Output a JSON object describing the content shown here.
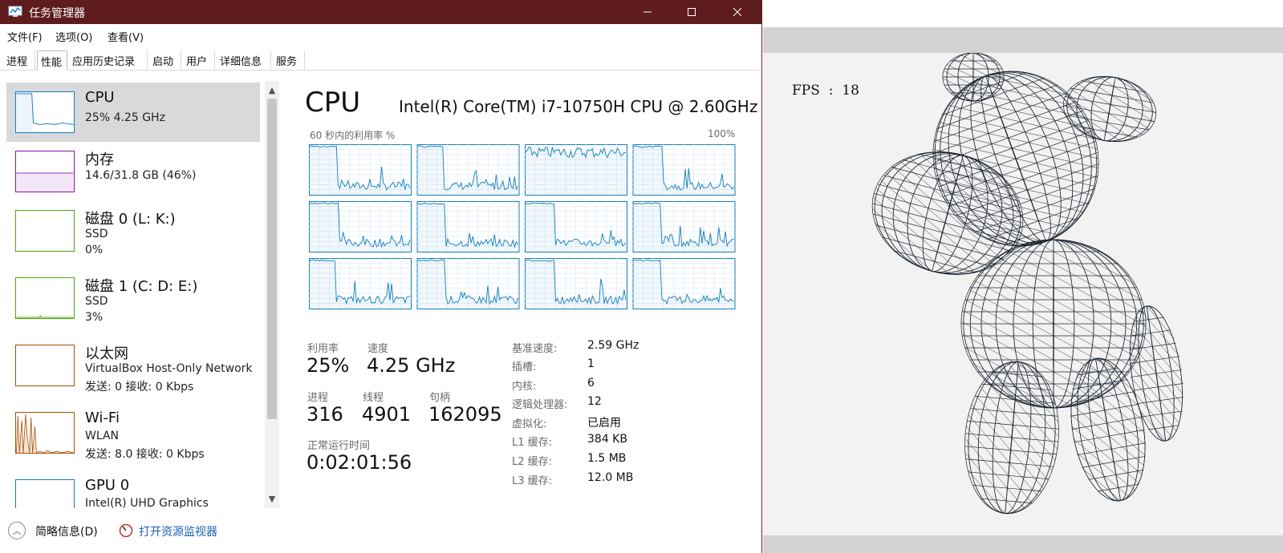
{
  "window": {
    "title": "任务管理器"
  },
  "menu": {
    "file": "文件(F)",
    "options": "选项(O)",
    "view": "查看(V)"
  },
  "tabs": [
    "进程",
    "性能",
    "应用历史记录",
    "启动",
    "用户",
    "详细信息",
    "服务"
  ],
  "sidebar": {
    "items": [
      {
        "title": "CPU",
        "line1": "25% 4.25 GHz",
        "line2": "",
        "color": "#117dbb"
      },
      {
        "title": "内存",
        "line1": "14.6/31.8 GB (46%)",
        "line2": "",
        "color": "#8b12ae"
      },
      {
        "title": "磁盘 0 (L: K:)",
        "line1": "SSD",
        "line2": "0%",
        "color": "#4da60c"
      },
      {
        "title": "磁盘 1 (C: D: E:)",
        "line1": "SSD",
        "line2": "3%",
        "color": "#4da60c"
      },
      {
        "title": "以太网",
        "line1": "VirtualBox Host-Only Network",
        "line2": "发送: 0 接收: 0 Kbps",
        "color": "#a74f01"
      },
      {
        "title": "Wi-Fi",
        "line1": "WLAN",
        "line2": "发送: 8.0 接收: 0 Kbps",
        "color": "#a74f01"
      },
      {
        "title": "GPU 0",
        "line1": "Intel(R) UHD Graphics",
        "line2": "",
        "color": "#117dbb"
      }
    ]
  },
  "cpu": {
    "heading": "CPU",
    "model": "Intel(R) Core(TM) i7-10750H CPU @ 2.60GHz",
    "graph_label": "60 秒内的利用率 %",
    "graph_max": "100%",
    "logical_graphs": 12,
    "stats": {
      "util_label": "利用率",
      "util_value": "25%",
      "speed_label": "速度",
      "speed_value": "4.25 GHz",
      "proc_label": "进程",
      "proc_value": "316",
      "thread_label": "线程",
      "thread_value": "4901",
      "handle_label": "句柄",
      "handle_value": "162095",
      "uptime_label": "正常运行时间",
      "uptime_value": "0:02:01:56"
    },
    "specs": [
      {
        "label": "基准速度:",
        "value": "2.59 GHz"
      },
      {
        "label": "插槽:",
        "value": "1"
      },
      {
        "label": "内核:",
        "value": "6"
      },
      {
        "label": "逻辑处理器:",
        "value": "12"
      },
      {
        "label": "虚拟化:",
        "value": "已启用"
      },
      {
        "label": "L1 缓存:",
        "value": "384 KB"
      },
      {
        "label": "L2 缓存:",
        "value": "1.5 MB"
      },
      {
        "label": "L3 缓存:",
        "value": "12.0 MB"
      }
    ]
  },
  "footer": {
    "fewer_details": "简略信息(D)",
    "resource_monitor": "打开资源监视器"
  },
  "viewer": {
    "fps_label": "FPS",
    "fps_sep": ":",
    "fps_value": "18"
  },
  "colors": {
    "titlebar": "#5e1c1c",
    "cpu_line": "#117dbb",
    "selected": "#d9d9d9",
    "link": "#1a5fb4"
  }
}
